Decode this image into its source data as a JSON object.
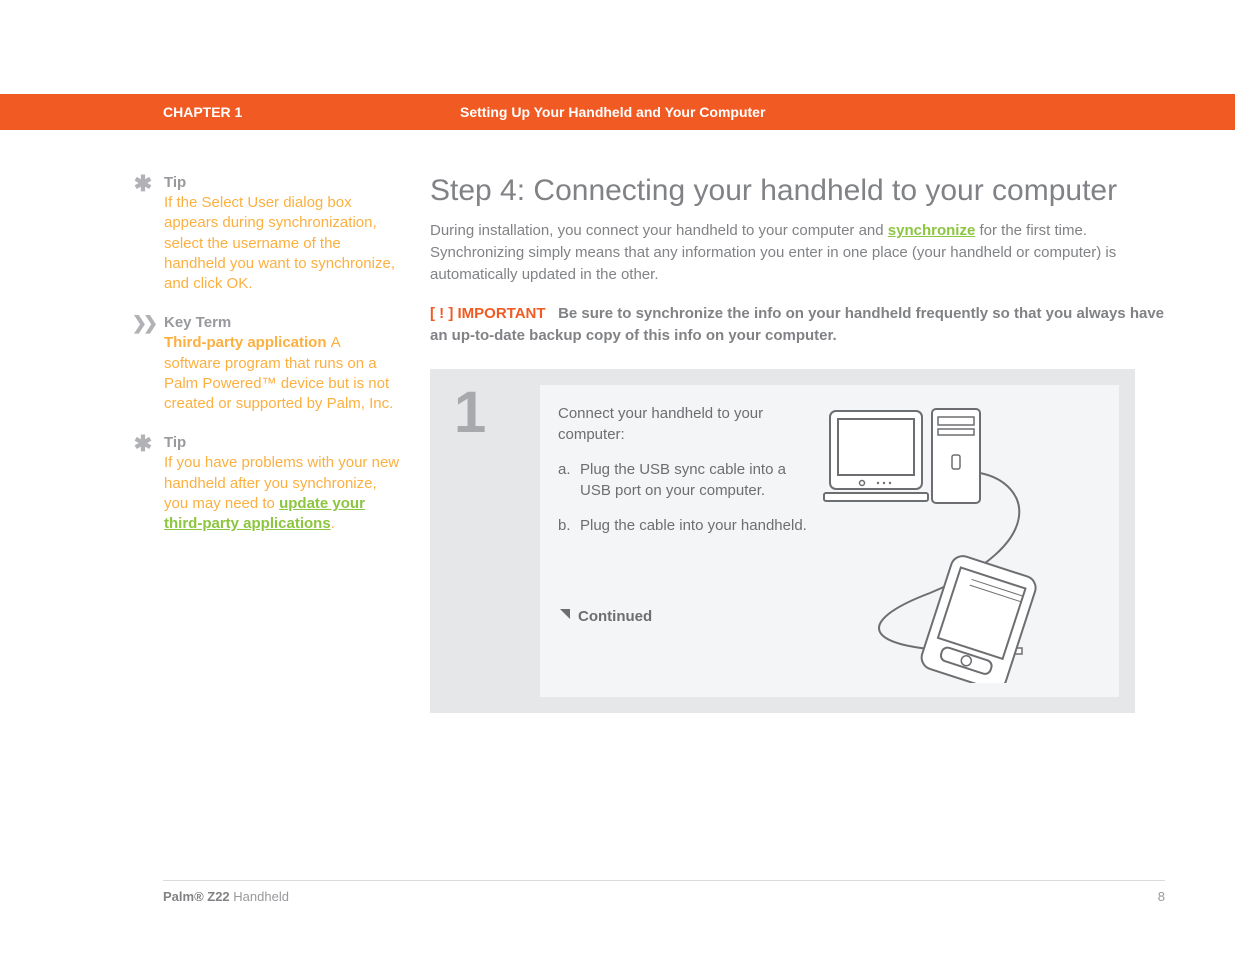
{
  "header": {
    "chapter": "CHAPTER 1",
    "title": "Setting Up Your Handheld and Your Computer"
  },
  "sidebar": {
    "blocks": [
      {
        "icon": "asterisk",
        "heading": "Tip",
        "body_parts": [
          {
            "t": "text",
            "v": "If the Select User dialog box appears during synchronization, select the username of the handheld you want to synchronize, and click OK."
          }
        ]
      },
      {
        "icon": "chevrons",
        "heading": "Key Term",
        "body_parts": [
          {
            "t": "term",
            "v": "Third-party application "
          },
          {
            "t": "text",
            "v": "A software program that runs on a Palm Powered™ device but is not created or supported by Palm, Inc."
          }
        ]
      },
      {
        "icon": "asterisk",
        "heading": "Tip",
        "body_parts": [
          {
            "t": "text",
            "v": "If you have problems with your new handheld after you synchronize, you may need to "
          },
          {
            "t": "link",
            "v": "update your third-party applications"
          },
          {
            "t": "text",
            "v": "."
          }
        ]
      }
    ]
  },
  "main": {
    "h1": "Step 4: Connecting your handheld to your computer",
    "intro_parts": [
      {
        "t": "text",
        "v": "During installation, you connect your handheld to your computer and "
      },
      {
        "t": "link",
        "v": "synchronize"
      },
      {
        "t": "text",
        "v": " for the first time. Synchronizing simply means that any information you enter in one place (your handheld or computer) is automatically updated in the other."
      }
    ],
    "important": {
      "tag": "[ ! ] IMPORTANT",
      "text": "Be sure to synchronize the info on your handheld frequently so that you always have an up-to-date backup copy of this info on your computer."
    },
    "step": {
      "number": "1",
      "lead": "Connect your handheld to your computer:",
      "items": [
        {
          "label": "a.",
          "text": "Plug the USB sync cable into a USB port on your computer."
        },
        {
          "label": "b.",
          "text": "Plug the cable into your handheld."
        }
      ],
      "continued": "Continued"
    }
  },
  "footer": {
    "product_bold": "Palm® Z22",
    "product_rest": " Handheld",
    "page": "8"
  }
}
